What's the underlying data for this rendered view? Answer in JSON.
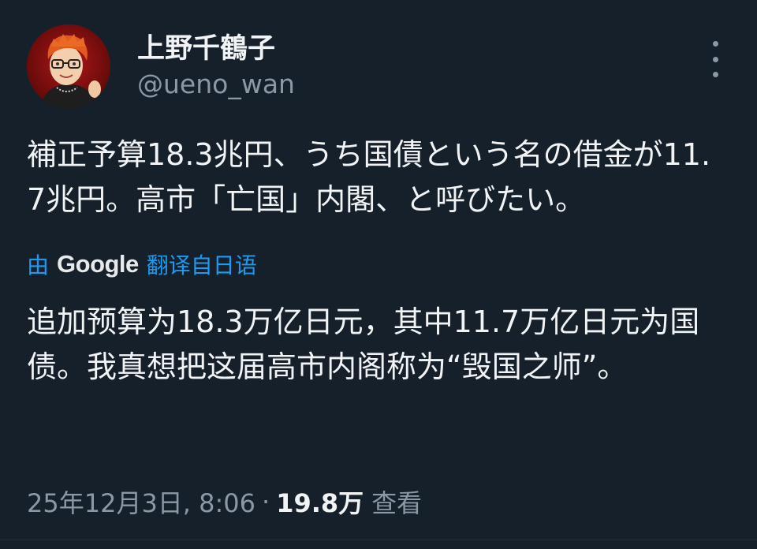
{
  "author": {
    "display_name": "上野千鶴子",
    "handle": "@ueno_wan"
  },
  "tweet": {
    "text": "補正予算18.3兆円、うち国債という名の借金が11.7兆円。高市「亡国」内閣、と呼びたい。"
  },
  "translation": {
    "prefix": "由",
    "provider": "Google",
    "source_label": "翻译自日语",
    "text": "追加预算为18.3万亿日元，其中11.7万亿日元为国债。我真想把这届高市内阁称为“毁国之师”。"
  },
  "meta": {
    "timestamp": "25年12月3日, 8:06",
    "separator": "·",
    "views": "19.8万",
    "views_label": "查看"
  },
  "colors": {
    "background": "#15202b",
    "accent": "#1d9bf0",
    "secondary_text": "#8b98a5"
  },
  "icons": {
    "more": "more-vertical-icon"
  }
}
